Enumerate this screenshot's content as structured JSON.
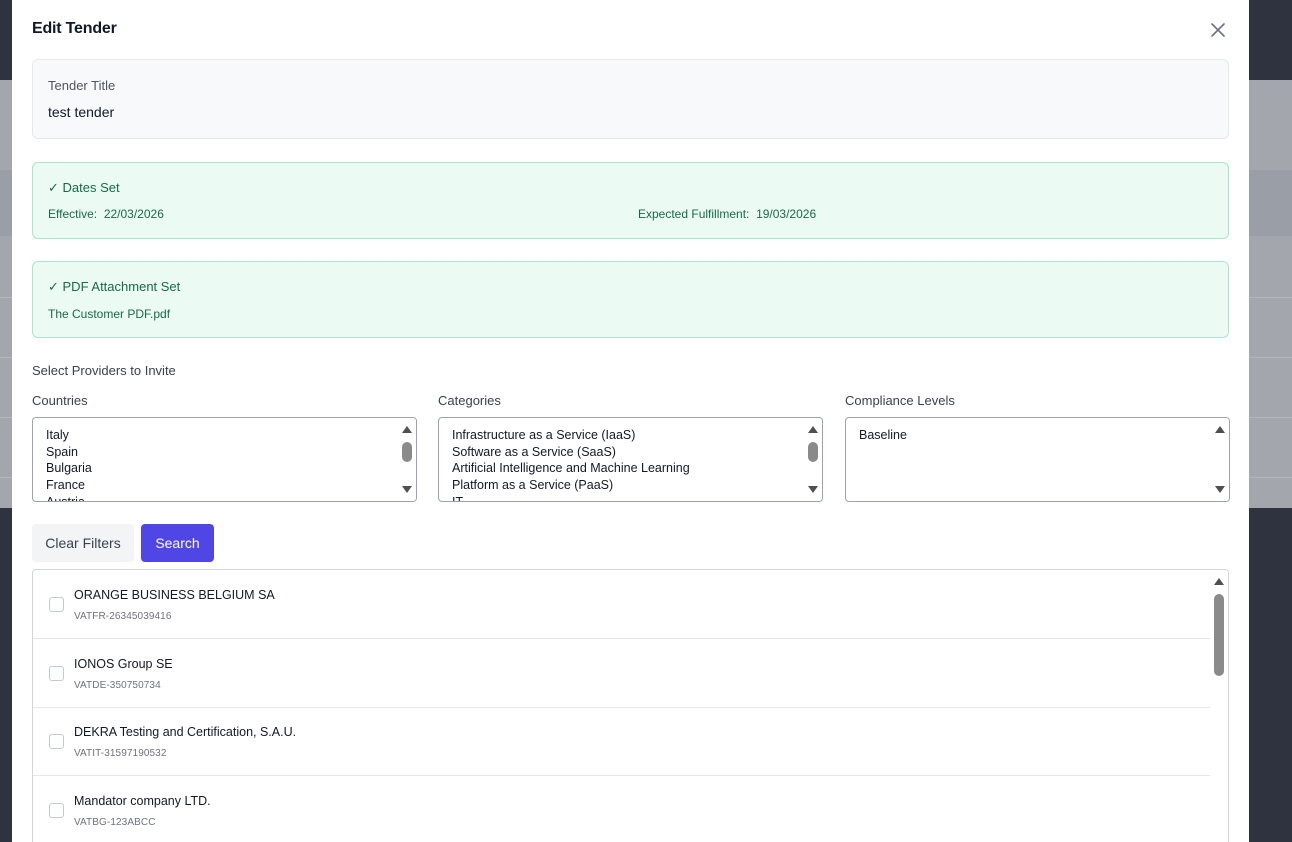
{
  "modal": {
    "title": "Edit Tender"
  },
  "tender_title": {
    "label": "Tender Title",
    "value": "test tender"
  },
  "dates": {
    "heading": "✓ Dates Set",
    "effective_label": "Effective:",
    "effective_value": "22/03/2026",
    "fulfillment_label": "Expected Fulfillment:",
    "fulfillment_value": "19/03/2026"
  },
  "pdf": {
    "heading": "✓ PDF Attachment Set",
    "filename": "The Customer PDF.pdf"
  },
  "providers_section": {
    "label": "Select Providers to Invite"
  },
  "filters": {
    "countries": {
      "label": "Countries",
      "options": [
        "Italy",
        "Spain",
        "Bulgaria",
        "France",
        "Austria"
      ]
    },
    "categories": {
      "label": "Categories",
      "options": [
        "Infrastructure as a Service (IaaS)",
        "Software as a Service (SaaS)",
        "Artificial Intelligence and Machine Learning",
        "Platform as a Service (PaaS)",
        "IT"
      ]
    },
    "compliance": {
      "label": "Compliance Levels",
      "options": [
        "Baseline"
      ]
    }
  },
  "buttons": {
    "clear": "Clear Filters",
    "search": "Search"
  },
  "providers": [
    {
      "name": "ORANGE BUSINESS BELGIUM SA",
      "vat": "VATFR-26345039416"
    },
    {
      "name": "IONOS Group SE",
      "vat": "VATDE-350750734"
    },
    {
      "name": "DEKRA Testing and Certification, S.A.U.",
      "vat": "VATIT-31597190532"
    },
    {
      "name": "Mandator company LTD.",
      "vat": "VATBG-123ABCC"
    }
  ],
  "colors": {
    "primary": "#5046e5",
    "success_bg": "#ecfaf4",
    "success_border": "#a7e6cd",
    "success_text": "#166a4a"
  },
  "icons": {
    "close": "close-icon",
    "checkmark": "checkmark-glyph"
  }
}
